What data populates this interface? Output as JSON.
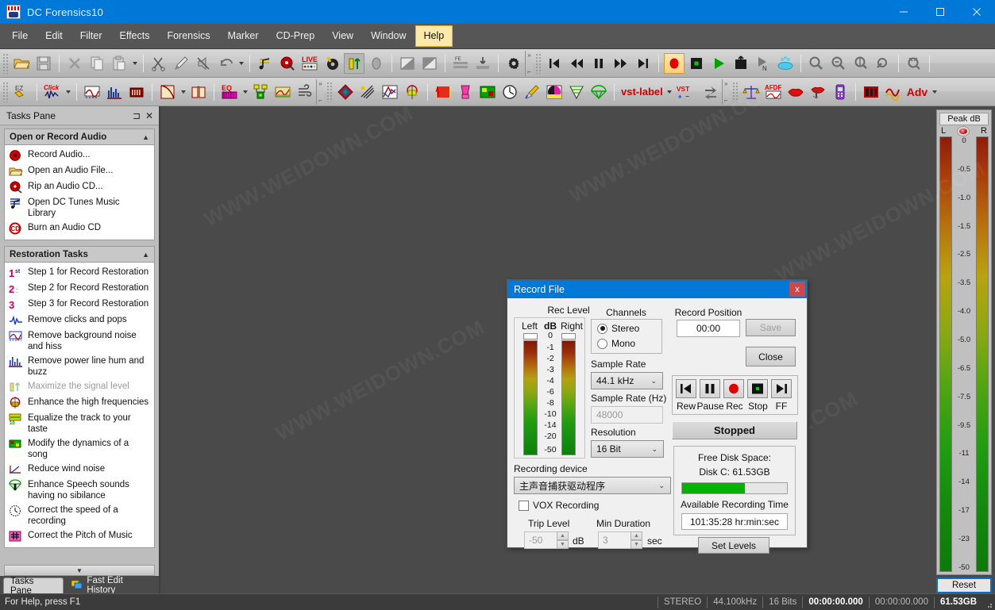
{
  "window": {
    "title": "DC Forensics10",
    "icon": "app-icon",
    "controls": {
      "minimize": "minimize-icon",
      "maximize": "maximize-icon",
      "close": "close-icon"
    }
  },
  "menubar": {
    "items": [
      {
        "label": "File",
        "active": false
      },
      {
        "label": "Edit",
        "active": false
      },
      {
        "label": "Filter",
        "active": false
      },
      {
        "label": "Effects",
        "active": false
      },
      {
        "label": "Forensics",
        "active": false
      },
      {
        "label": "Marker",
        "active": false
      },
      {
        "label": "CD-Prep",
        "active": false
      },
      {
        "label": "View",
        "active": false
      },
      {
        "label": "Window",
        "active": false
      },
      {
        "label": "Help",
        "active": true
      }
    ]
  },
  "toolbar_top": {
    "items": [
      "open-file-icon",
      "save-icon",
      "sep",
      "delete-icon",
      "copy-icon",
      "paste-icon",
      "paste-dropdown-caret",
      "sep",
      "cut-scissors-icon",
      "pencil-draw-icon",
      "mute-icon",
      "undo-icon",
      "undo-dropdown-caret",
      "sep",
      "audio-notes-icon",
      "cd-rip-icon",
      "live-icon",
      "audio-key-icon",
      "maximize-level-icon",
      "stone-icon",
      "sep",
      "fade-in-icon",
      "fade-out-icon",
      "sep",
      "fe-stack-icon",
      "align-icon",
      "sep",
      "settings-gear-icon"
    ],
    "transport": [
      "skip-start-icon",
      "rewind-icon",
      "pause-icon",
      "fast-forward-icon",
      "skip-end-icon",
      "record-icon",
      "stop-icon",
      "play-icon",
      "export-icon",
      "play-n-icon",
      "cd-burn-icon"
    ],
    "zoom": [
      "zoom-out-icon",
      "zoom-sel-icon",
      "zoom-vert-icon",
      "zoom-in-icon",
      "zoom-full-icon"
    ]
  },
  "toolbar_second": {
    "items": [
      "ez-tag-icon",
      "click-repair-icon",
      "click-dropdown-caret",
      "sep",
      "noise-curve-icon",
      "spectrum-icon",
      "multifilter-icon",
      "sep",
      "envelope-icon",
      "envelope-dropdown-caret",
      "book-icon",
      "sep",
      "eq-icon",
      "eq-dropdown-caret",
      "dynamics-icon",
      "declip-icon",
      "wind-noise-icon"
    ],
    "items2": [
      "virtual-valve-icon",
      "hiss-removal-icon",
      "pitch-shift-icon",
      "enhance-icon",
      "sep",
      "comb-filter-icon",
      "blender-icon",
      "dynamics2-icon",
      "speed-icon",
      "brush-icon",
      "pitch-music-icon",
      "funnel-icon",
      "parachute-icon",
      "sep",
      "vst-label",
      "vst-dropdown-caret",
      "vst-plus-label",
      "swap-icon"
    ],
    "items3": [
      "forensics-balance-icon",
      "afdf-icon",
      "lips-icon",
      "voice-icon",
      "phone-icon",
      "sep",
      "spectrogram-icon",
      "amplitude-icon",
      "adv-label",
      "adv-dropdown-caret"
    ]
  },
  "tasks_pane": {
    "title": "Tasks Pane",
    "pin_icon": "pin-icon",
    "close_icon": "close-icon",
    "groups": [
      {
        "title": "Open or Record Audio",
        "items": [
          {
            "label": "Record Audio...",
            "icon": "record-audio-icon",
            "disabled": false
          },
          {
            "label": "Open an Audio File...",
            "icon": "open-folder-icon",
            "disabled": false
          },
          {
            "label": "Rip an Audio CD...",
            "icon": "rip-cd-icon",
            "disabled": false
          },
          {
            "label": "Open DC Tunes Music Library",
            "icon": "music-library-icon",
            "disabled": false
          },
          {
            "label": "Burn an Audio CD",
            "icon": "burn-cd-icon",
            "disabled": false
          }
        ]
      },
      {
        "title": "Restoration Tasks",
        "items": [
          {
            "label": "Step 1 for Record Restoration",
            "icon": "step-1-icon",
            "disabled": false
          },
          {
            "label": "Step 2 for Record Restoration",
            "icon": "step-2-icon",
            "disabled": false
          },
          {
            "label": "Step 3 for Record Restoration",
            "icon": "step-3-icon",
            "disabled": false
          },
          {
            "label": "Remove clicks and pops",
            "icon": "click-pop-icon",
            "disabled": false
          },
          {
            "label": "Remove background noise and hiss",
            "icon": "noise-hiss-icon",
            "disabled": false
          },
          {
            "label": "Remove power line hum and buzz",
            "icon": "hum-buzz-icon",
            "disabled": false
          },
          {
            "label": "Maximize the signal level",
            "icon": "maximize-signal-icon",
            "disabled": true
          },
          {
            "label": "Enhance the high frequencies",
            "icon": "high-freq-icon",
            "disabled": false
          },
          {
            "label": "Equalize the track to your taste",
            "icon": "equalizer-icon",
            "disabled": false
          },
          {
            "label": "Modify the dynamics of a song",
            "icon": "dynamics-icon",
            "disabled": false
          },
          {
            "label": "Reduce wind noise",
            "icon": "wind-noise-icon",
            "disabled": false
          },
          {
            "label": "Enhance Speech sounds having no sibilance",
            "icon": "speech-enhance-icon",
            "disabled": false
          },
          {
            "label": "Correct the speed of a recording",
            "icon": "speed-correct-icon",
            "disabled": false
          },
          {
            "label": "Correct the Pitch of Music",
            "icon": "pitch-correct-icon",
            "disabled": false
          }
        ]
      }
    ],
    "scroll_down_icon": "chevron-down-icon",
    "tabs": [
      {
        "label": "Tasks Pane",
        "active": true,
        "icon": ""
      },
      {
        "label": "Fast Edit History",
        "active": false,
        "icon": "history-icon"
      }
    ]
  },
  "peak_meter": {
    "title": "Peak dB",
    "left_label": "L",
    "right_label": "R",
    "clip_led": "clip-led-icon",
    "scale": [
      "0",
      "-0.5",
      "-1.0",
      "-1.5",
      "-2.5",
      "-3.5",
      "-4.0",
      "-5.0",
      "-6.5",
      "-7.5",
      "-9.5",
      "-11",
      "-14",
      "-17",
      "-23",
      "-50"
    ],
    "reset_label": "Reset"
  },
  "dialog": {
    "title": "Record File",
    "close_label": "x",
    "rec_level": {
      "group_label": "Rec Level",
      "left_label": "Left",
      "db_label": "dB",
      "right_label": "Right",
      "scale": [
        "0",
        "-1",
        "-2",
        "-3",
        "-4",
        "-6",
        "-8",
        "-10",
        "-14",
        "-20",
        "-50"
      ]
    },
    "channels": {
      "group_label": "Channels",
      "options": [
        {
          "label": "Stereo",
          "selected": true
        },
        {
          "label": "Mono",
          "selected": false
        }
      ]
    },
    "sample_rate": {
      "label": "Sample Rate",
      "value": "44.1 kHz"
    },
    "sample_rate_hz": {
      "label": "Sample Rate (Hz)",
      "value": "48000",
      "disabled": true
    },
    "resolution": {
      "label": "Resolution",
      "value": "16 Bit"
    },
    "recording_device": {
      "label": "Recording device",
      "value": "主声音捕获驱动程序"
    },
    "vox": {
      "label": "VOX Recording",
      "checked": false
    },
    "trip_level": {
      "label": "Trip Level",
      "value": "-50",
      "unit": "dB",
      "disabled": true
    },
    "min_duration": {
      "label": "Min Duration",
      "value": "3",
      "unit": "sec",
      "disabled": true
    },
    "record_position": {
      "label": "Record Position",
      "value": "00:00"
    },
    "save_button": {
      "label": "Save",
      "disabled": true
    },
    "close_button": {
      "label": "Close"
    },
    "transport": [
      {
        "label": "Rew",
        "icon": "skip-start-icon"
      },
      {
        "label": "Pause",
        "icon": "pause-icon"
      },
      {
        "label": "Rec",
        "icon": "record-icon"
      },
      {
        "label": "Stop",
        "icon": "stop-icon"
      },
      {
        "label": "FF",
        "icon": "skip-end-icon"
      }
    ],
    "status": "Stopped",
    "disk": {
      "title": "Free Disk Space:",
      "drive_line": "Disk C:   61.53GB",
      "bar_percent": 60,
      "time_label": "Available Recording Time",
      "time_value": "101:35:28 hr:min:sec"
    },
    "set_levels_button": {
      "label": "Set Levels"
    }
  },
  "statusbar": {
    "help_text": "For Help, press F1",
    "cells": [
      {
        "text": "STEREO",
        "bright": false
      },
      {
        "text": "44.100kHz",
        "bright": false
      },
      {
        "text": "16 Bits",
        "bright": false
      },
      {
        "text": "00:00:00.000",
        "bright": true
      },
      {
        "text": "00:00:00.000",
        "bright": false
      },
      {
        "text": "61.53GB",
        "bright": true
      }
    ]
  },
  "watermarks": [
    "WWW.WEIDOWN.COM",
    "WWW.WEIDOWN.COM",
    "WWW.WEIDOWN.COM",
    "WWW.WEIDOWN.COM",
    "WWW.WEIDOWN.COM"
  ],
  "colors": {
    "accent": "#0078d7",
    "menubar_bg": "#565656",
    "canvas_bg": "#4a4a4a",
    "toolbar_bg": "#c9c9c9",
    "dialog_bg": "#f0f0f0",
    "meter_green": "#00b200",
    "record_red": "#e00000"
  }
}
